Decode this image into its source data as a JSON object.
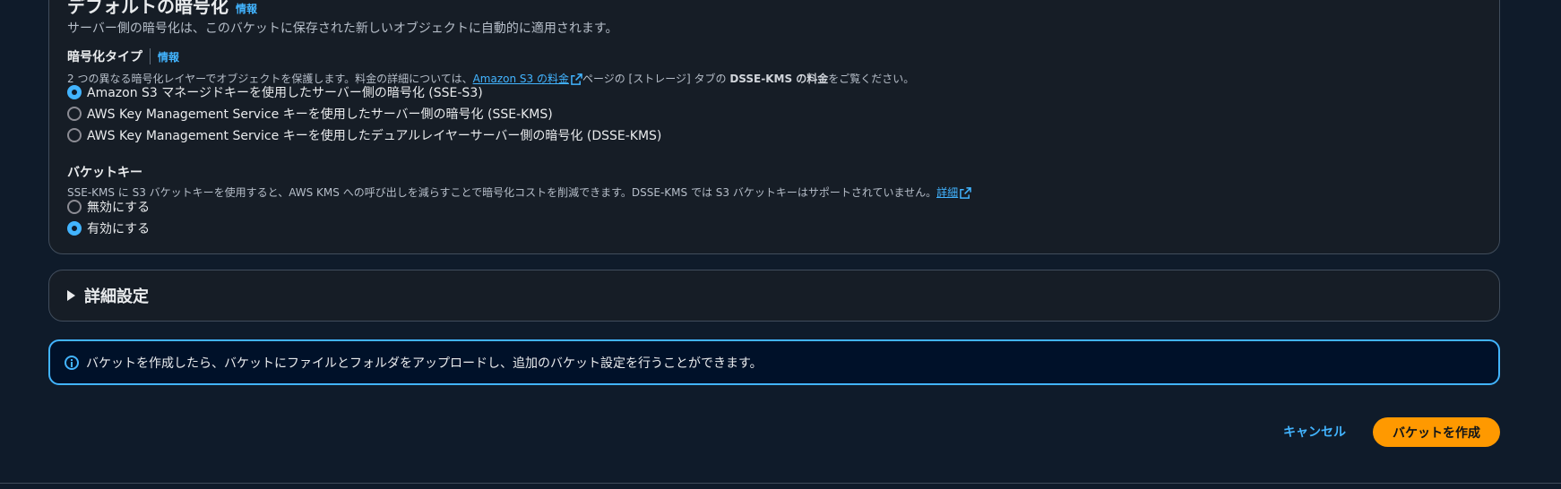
{
  "default_encryption": {
    "title": "デフォルトの暗号化",
    "info_link": "情報",
    "description": "サーバー側の暗号化は、このバケットに保存された新しいオブジェクトに自動的に適用されます。"
  },
  "encryption_type": {
    "label": "暗号化タイプ",
    "info_link": "情報",
    "desc_prefix": "2 つの異なる暗号化レイヤーでオブジェクトを保護します。料金の詳細については、",
    "desc_link": "Amazon S3 の料金",
    "desc_middle": "ページの [ストレージ] タブの",
    "desc_bold": "DSSE-KMS の料金",
    "desc_suffix": "をご覧ください。",
    "options": [
      {
        "label": "Amazon S3 マネージドキーを使用したサーバー側の暗号化 (SSE-S3)",
        "checked": true
      },
      {
        "label": "AWS Key Management Service キーを使用したサーバー側の暗号化 (SSE-KMS)",
        "checked": false
      },
      {
        "label": "AWS Key Management Service キーを使用したデュアルレイヤーサーバー側の暗号化 (DSSE-KMS)",
        "checked": false
      }
    ]
  },
  "bucket_key": {
    "label": "バケットキー",
    "description": "SSE-KMS に S3 バケットキーを使用すると、AWS KMS への呼び出しを減らすことで暗号化コストを削減できます。DSSE-KMS では S3 バケットキーはサポートされていません。",
    "learn_more": "詳細",
    "options": [
      {
        "label": "無効にする",
        "checked": false
      },
      {
        "label": "有効にする",
        "checked": true
      }
    ]
  },
  "advanced_settings": {
    "label": "詳細設定"
  },
  "alert": {
    "text": "バケットを作成したら、バケットにファイルとフォルダをアップロードし、追加のバケット設定を行うことができます。"
  },
  "footer": {
    "cancel_label": "キャンセル",
    "create_label": "バケットを作成"
  },
  "colors": {
    "background": "#0f1b2a",
    "link": "#42b4ff",
    "primary_button": "#ff9900",
    "alert_border": "#42b4ff"
  }
}
